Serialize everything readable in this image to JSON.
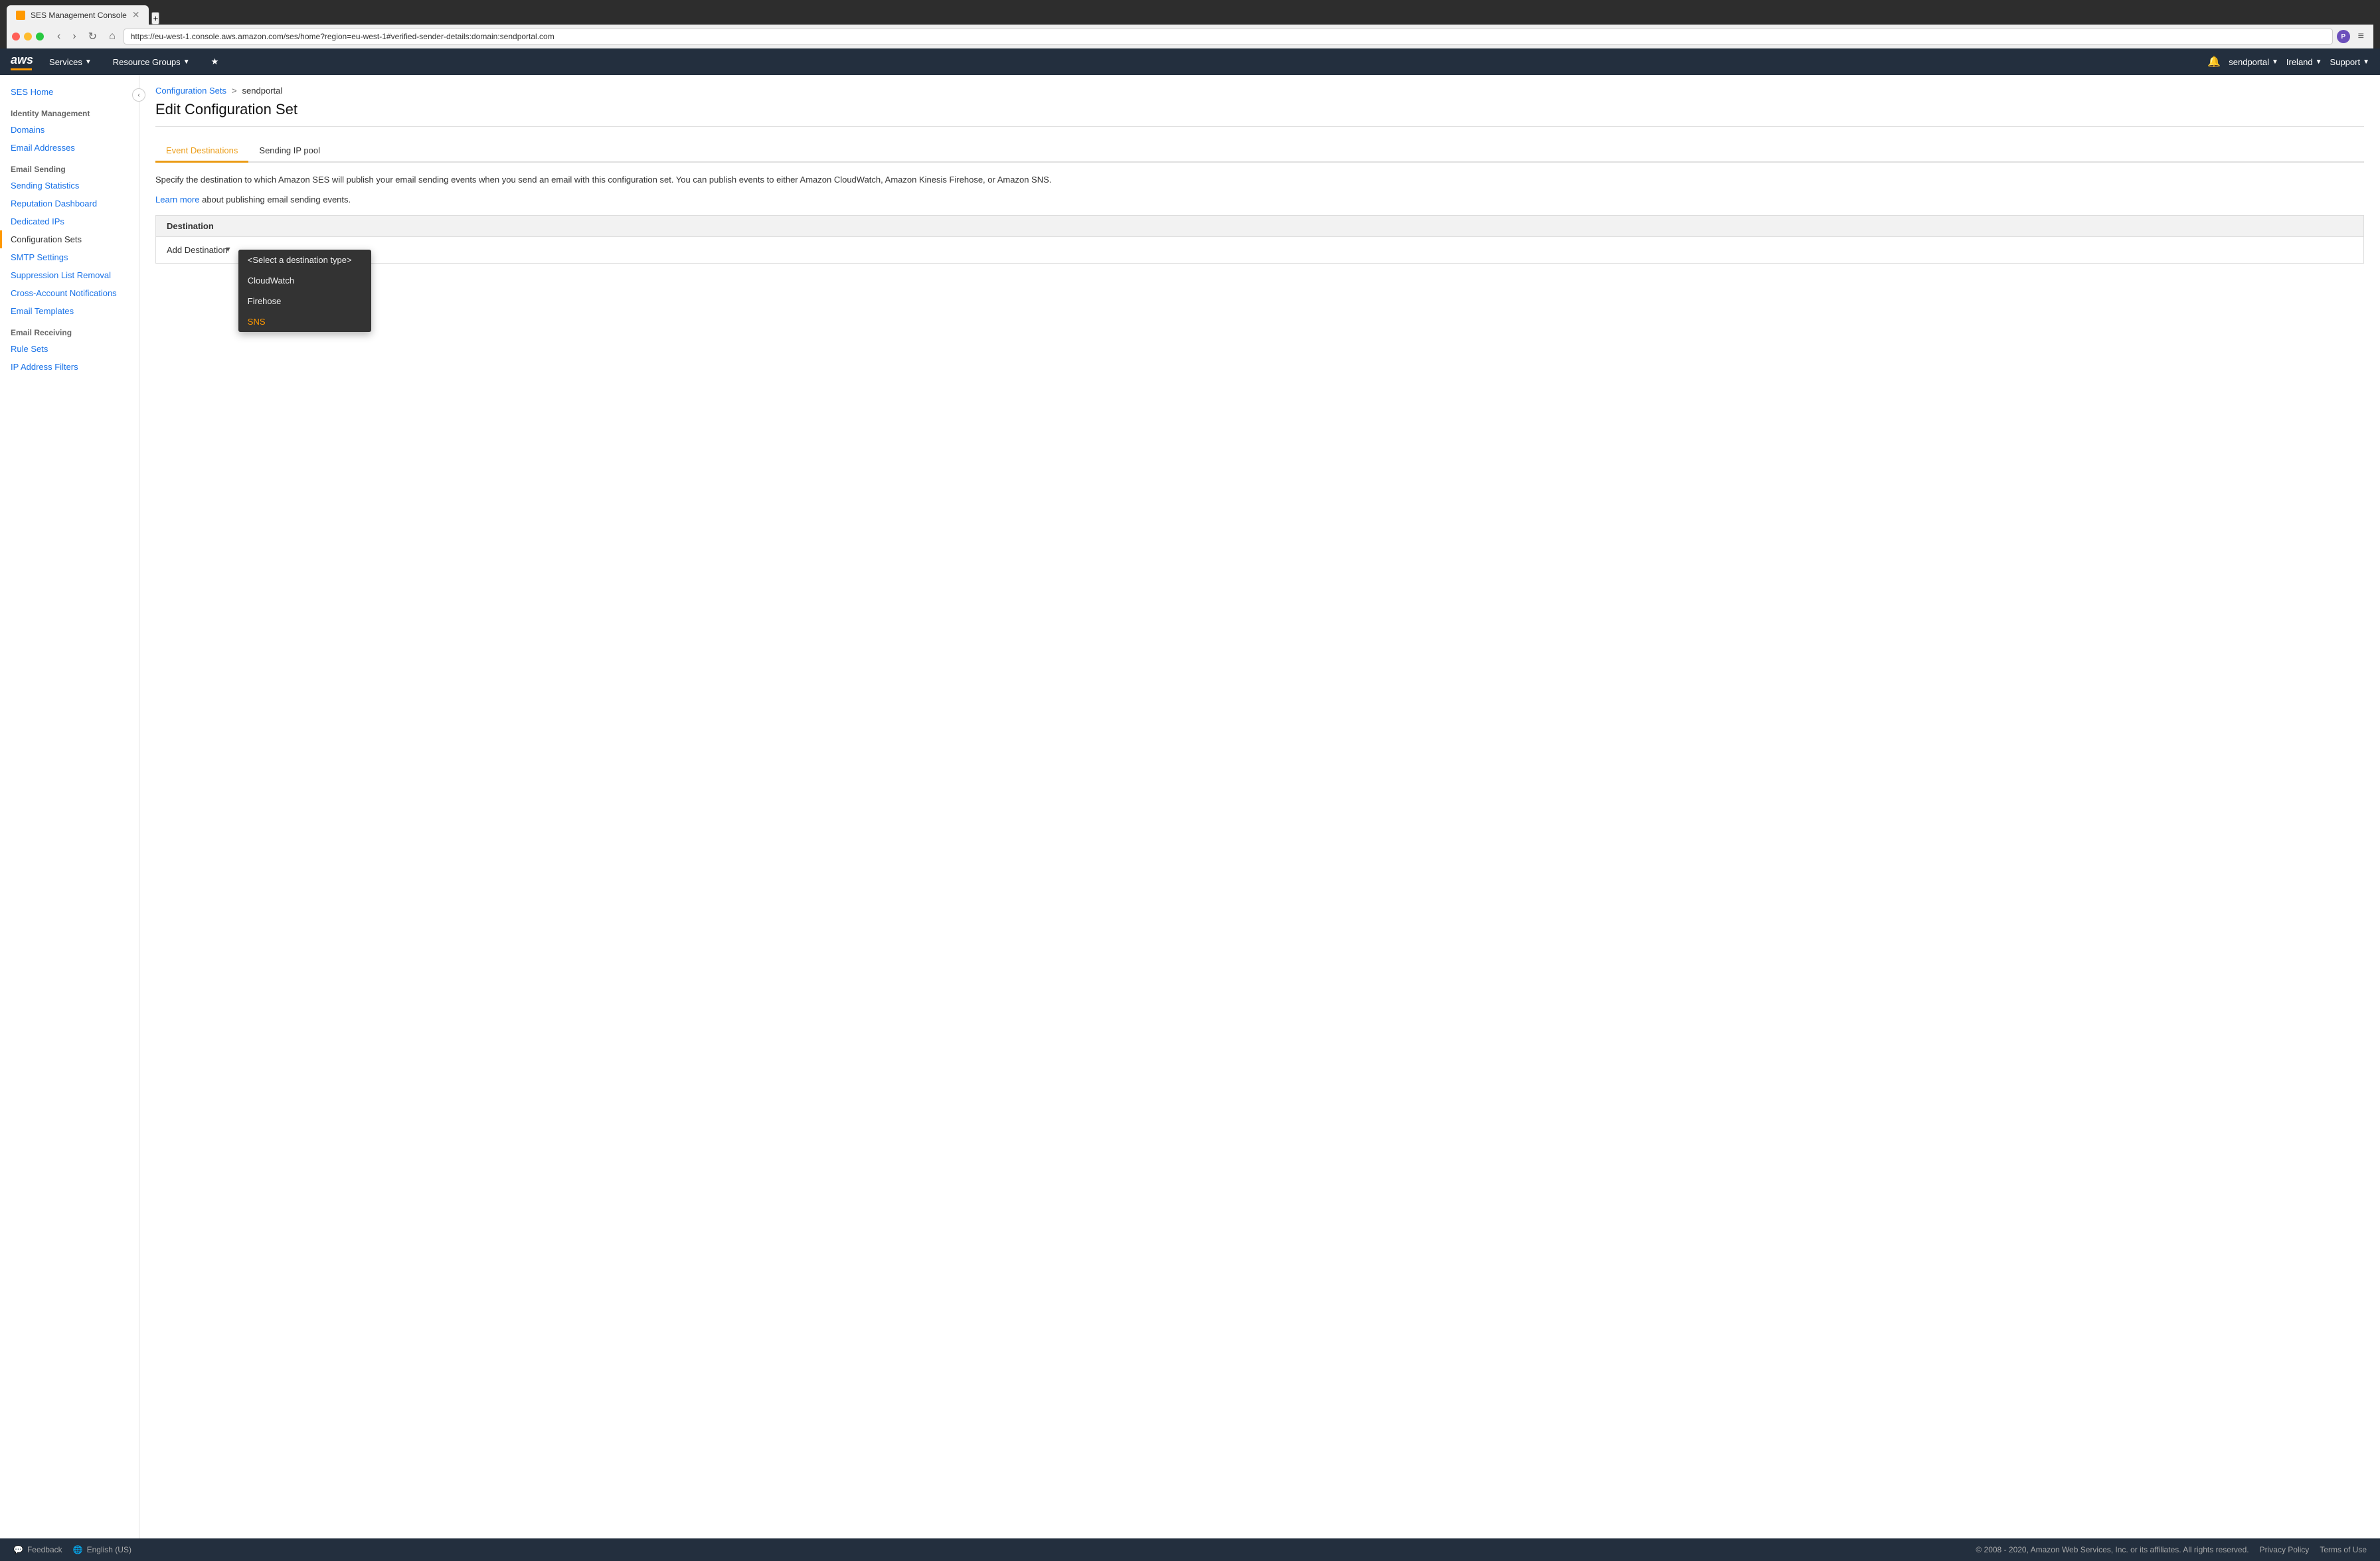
{
  "browser": {
    "tab_favicon": "SES",
    "tab_title": "SES Management Console",
    "url": "https://eu-west-1.console.aws.amazon.com/ses/home?region=eu-west-1#verified-sender-details:domain:sendportal.com",
    "new_tab_symbol": "+"
  },
  "aws_header": {
    "logo_text": "aws",
    "nav_items": [
      {
        "label": "Services",
        "has_dropdown": true
      },
      {
        "label": "Resource Groups",
        "has_dropdown": true
      },
      {
        "label": "★",
        "has_dropdown": false
      }
    ],
    "right": {
      "bell_icon": "🔔",
      "account": "sendportal",
      "region": "Ireland",
      "support": "Support"
    }
  },
  "sidebar": {
    "ses_home_label": "SES Home",
    "identity_management_label": "Identity Management",
    "domains_label": "Domains",
    "email_addresses_label": "Email Addresses",
    "email_sending_label": "Email Sending",
    "sending_statistics_label": "Sending Statistics",
    "reputation_dashboard_label": "Reputation Dashboard",
    "dedicated_ips_label": "Dedicated IPs",
    "configuration_sets_label": "Configuration Sets",
    "smtp_settings_label": "SMTP Settings",
    "suppression_list_label": "Suppression List Removal",
    "cross_account_label": "Cross-Account Notifications",
    "email_templates_label": "Email Templates",
    "email_receiving_label": "Email Receiving",
    "rule_sets_label": "Rule Sets",
    "ip_address_filters_label": "IP Address Filters"
  },
  "breadcrumb": {
    "config_sets_link": "Configuration Sets",
    "separator": ">",
    "current": "sendportal"
  },
  "page": {
    "title": "Edit Configuration Set",
    "tabs": [
      {
        "label": "Event Destinations",
        "active": true
      },
      {
        "label": "Sending IP pool",
        "active": false
      }
    ],
    "description": "Specify the destination to which Amazon SES will publish your email sending events when you send an email with this configuration set. You can publish events to either Amazon CloudWatch, Amazon Kinesis Firehose, or Amazon SNS.",
    "learn_more_text": "Learn more",
    "learn_more_suffix": " about publishing email sending events.",
    "destination_header": "Destination",
    "add_destination_label": "Add Destination",
    "select_placeholder": "<Select a destination type>",
    "dropdown_options": [
      {
        "label": "<Select a destination type>",
        "highlighted": false
      },
      {
        "label": "CloudWatch",
        "highlighted": false
      },
      {
        "label": "Firehose",
        "highlighted": false
      },
      {
        "label": "SNS",
        "highlighted": true
      }
    ]
  },
  "footer": {
    "feedback_label": "Feedback",
    "language_label": "English (US)",
    "copyright": "© 2008 - 2020, Amazon Web Services, Inc. or its affiliates. All rights reserved.",
    "privacy_policy": "Privacy Policy",
    "terms_of_use": "Terms of Use"
  }
}
